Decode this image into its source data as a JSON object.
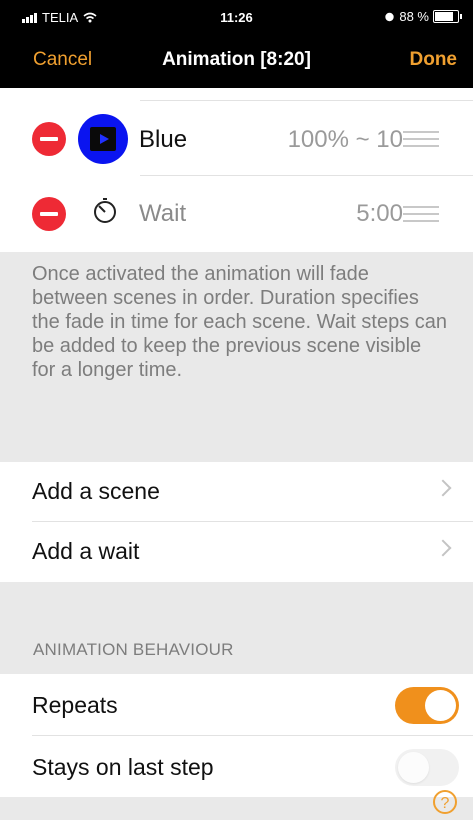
{
  "status_bar": {
    "carrier": "TELIA",
    "time": "11:26",
    "battery_text": "88 %",
    "battery_level": 0.88
  },
  "nav": {
    "cancel": "Cancel",
    "title": "Animation [8:20]",
    "done": "Done"
  },
  "steps": [
    {
      "label": "Blue",
      "value": "100% ~ 10",
      "icon": "scene-play-icon",
      "icon_color": "#0a14f0"
    },
    {
      "label": "Wait",
      "value": "5:00",
      "icon": "stopwatch-icon"
    }
  ],
  "info_text": "Once activated the animation will fade between scenes in order. Duration specifies the fade in time for each scene. Wait steps can be added to keep the previous scene visible for a longer time.",
  "actions": [
    {
      "label": "Add a scene"
    },
    {
      "label": "Add a wait"
    }
  ],
  "behaviour": {
    "header": "ANIMATION BEHAVIOUR",
    "repeats": {
      "label": "Repeats",
      "on": true
    },
    "stays_on_last": {
      "label": "Stays on last step",
      "on": false
    }
  },
  "help_icon": "?",
  "colors": {
    "accent": "#f0a030",
    "delete": "#ee2a35",
    "toggle_on": "#f0901c"
  }
}
